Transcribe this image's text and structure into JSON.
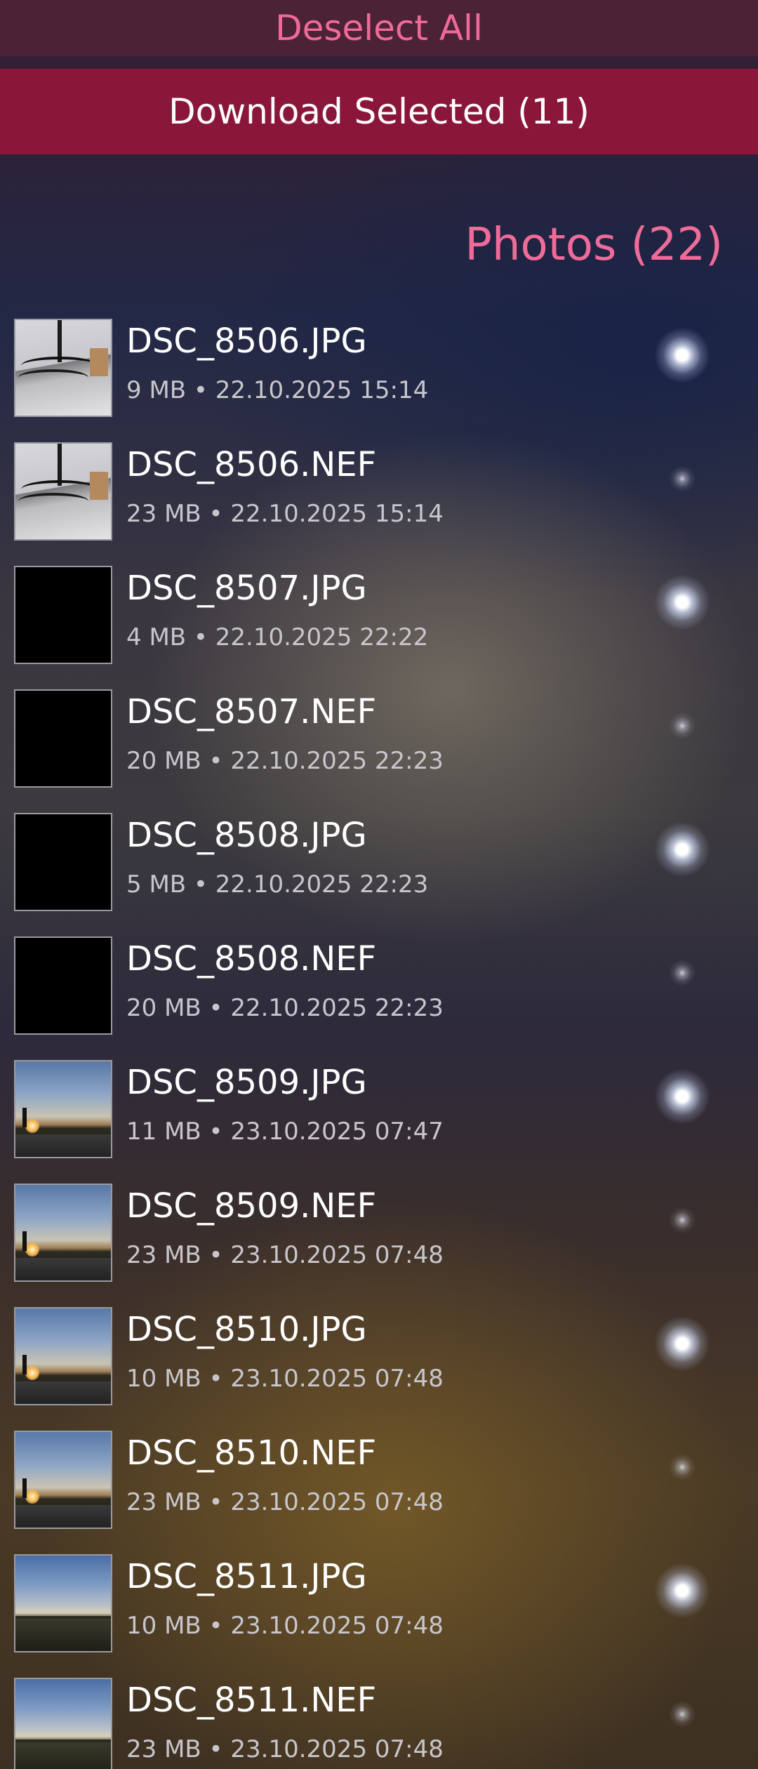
{
  "header": {
    "deselect_all_label": "Deselect All",
    "download_selected_label": "Download Selected (11)"
  },
  "section": {
    "title": "Photos (22)"
  },
  "colors": {
    "accent": "#ef6b98",
    "download_bar": "#8a1739"
  },
  "photos": [
    {
      "name": "DSC_8506.JPG",
      "meta": "9 MB • 22.10.2025 15:14",
      "selected": true,
      "thumb": "desk"
    },
    {
      "name": "DSC_8506.NEF",
      "meta": "23 MB • 22.10.2025 15:14",
      "selected": false,
      "thumb": "desk"
    },
    {
      "name": "DSC_8507.JPG",
      "meta": "4 MB • 22.10.2025 22:22",
      "selected": true,
      "thumb": "black"
    },
    {
      "name": "DSC_8507.NEF",
      "meta": "20 MB • 22.10.2025 22:23",
      "selected": false,
      "thumb": "black"
    },
    {
      "name": "DSC_8508.JPG",
      "meta": "5 MB • 22.10.2025 22:23",
      "selected": true,
      "thumb": "black"
    },
    {
      "name": "DSC_8508.NEF",
      "meta": "20 MB • 22.10.2025 22:23",
      "selected": false,
      "thumb": "black"
    },
    {
      "name": "DSC_8509.JPG",
      "meta": "11 MB • 23.10.2025 07:47",
      "selected": true,
      "thumb": "sunset"
    },
    {
      "name": "DSC_8509.NEF",
      "meta": "23 MB • 23.10.2025 07:48",
      "selected": false,
      "thumb": "sunset"
    },
    {
      "name": "DSC_8510.JPG",
      "meta": "10 MB • 23.10.2025 07:48",
      "selected": true,
      "thumb": "sunset"
    },
    {
      "name": "DSC_8510.NEF",
      "meta": "23 MB • 23.10.2025 07:48",
      "selected": false,
      "thumb": "sunset"
    },
    {
      "name": "DSC_8511.JPG",
      "meta": "10 MB • 23.10.2025 07:48",
      "selected": true,
      "thumb": "cloudy"
    },
    {
      "name": "DSC_8511.NEF",
      "meta": "23 MB • 23.10.2025 07:48",
      "selected": false,
      "thumb": "cloudy"
    }
  ]
}
